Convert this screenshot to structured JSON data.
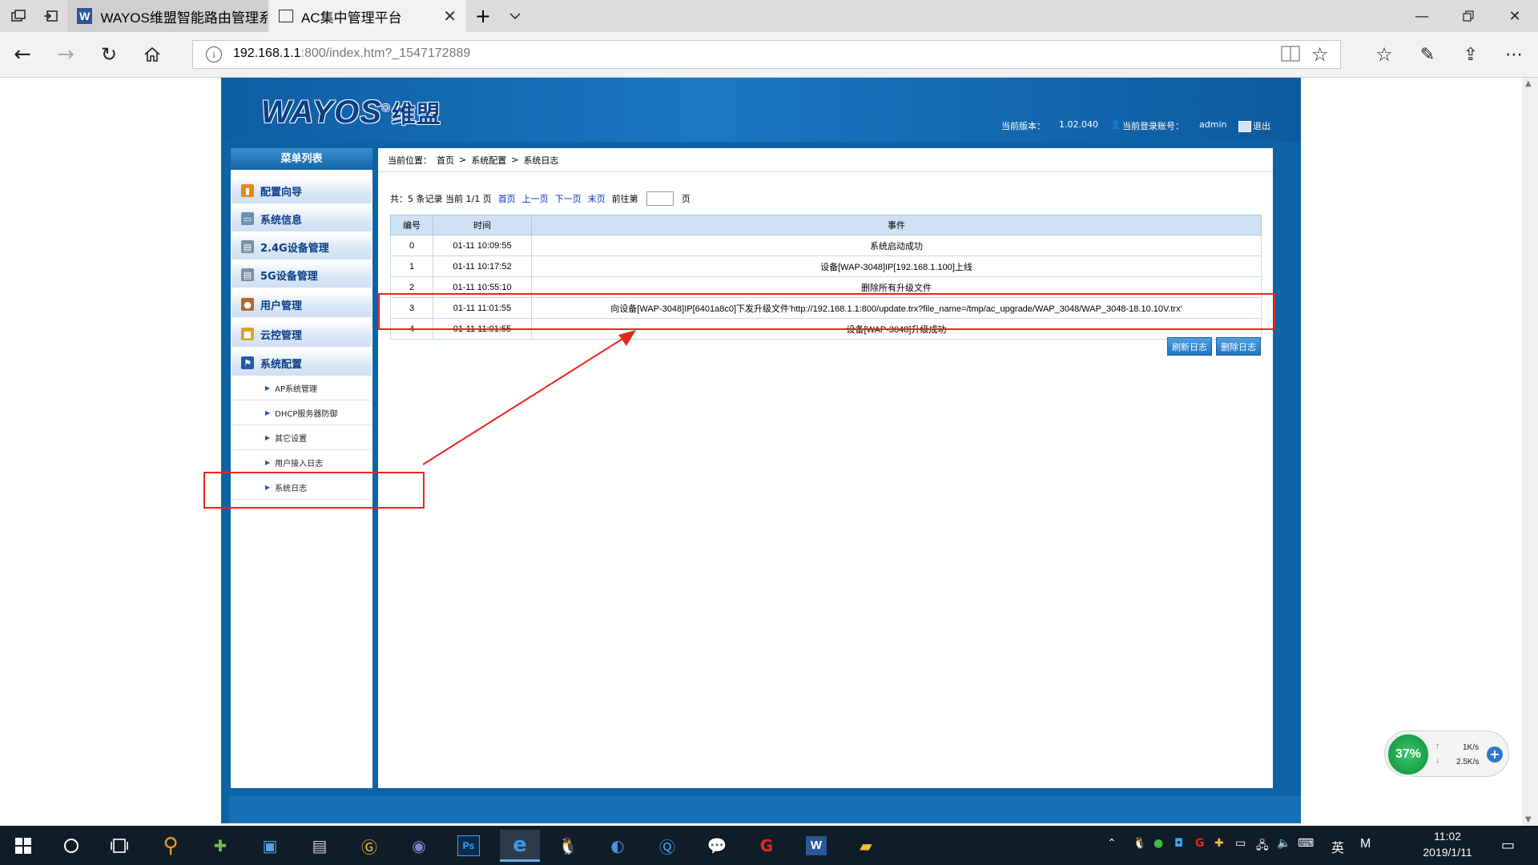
{
  "browser": {
    "tabs": [
      {
        "title": "WAYOS维盟智能路由管理系"
      },
      {
        "title": "AC集中管理平台"
      }
    ],
    "address": {
      "host": "192.168.1.1",
      "rest": ":800/index.htm?_1547172889"
    }
  },
  "header": {
    "brand": "WAYOS",
    "brand_cn": "维盟",
    "version_label": "当前版本：",
    "version": "1.02.040",
    "account_label": "当前登录账号：",
    "account": "admin",
    "logout": "退出"
  },
  "sidebar": {
    "title": "菜单列表",
    "items": [
      {
        "label": "配置向导",
        "icon": "wizard-icon"
      },
      {
        "label": "系统信息",
        "icon": "monitor-icon"
      },
      {
        "label": "2.4G设备管理",
        "icon": "device-icon"
      },
      {
        "label": "5G设备管理",
        "icon": "device-icon"
      },
      {
        "label": "用户管理",
        "icon": "user-icon"
      },
      {
        "label": "云控管理",
        "icon": "lock-icon"
      },
      {
        "label": "系统配置",
        "icon": "flag-icon"
      }
    ],
    "subitems": [
      {
        "label": "AP系统管理"
      },
      {
        "label": "DHCP服务器防御"
      },
      {
        "label": "其它设置"
      },
      {
        "label": "用户接入日志"
      },
      {
        "label": "系统日志"
      }
    ]
  },
  "breadcrumb": {
    "label": "当前位置：",
    "home": "首页",
    "section": "系统配置",
    "current": "系统日志"
  },
  "pager": {
    "summary": "共：5 条记录 当前 1/1 页",
    "first": "首页",
    "prev": "上一页",
    "next": "下一页",
    "last": "末页",
    "goto_label": "前往第",
    "goto_suffix": "页"
  },
  "table": {
    "headers": [
      "编号",
      "时间",
      "事件"
    ],
    "rows": [
      [
        "0",
        "01-11 10:09:55",
        "系统启动成功"
      ],
      [
        "1",
        "01-11 10:17:52",
        "设备[WAP-3048]IP[192.168.1.100]上线"
      ],
      [
        "2",
        "01-11 10:55:10",
        "删除所有升级文件"
      ],
      [
        "3",
        "01-11 11:01:55",
        "向设备[WAP-3048]IP[6401a8c0]下发升级文件'http://192.168.1.1:800/update.trx?file_name=/tmp/ac_upgrade/WAP_3048/WAP_3048-18.10.10V.trx'"
      ],
      [
        "4",
        "01-11 11:01:55",
        "设备[WAP-3048]升级成功"
      ]
    ]
  },
  "buttons": {
    "refresh": "刷新日志",
    "delete": "删除日志"
  },
  "network": {
    "percent": "37%",
    "up": "1K/s",
    "down": "2.5K/s"
  },
  "taskbar": {
    "ime": "英",
    "m": "M",
    "time": "11:02",
    "date": "2019/1/11"
  },
  "colors": {
    "accent": "#0d63a6",
    "annotation": "#e8261d",
    "link": "#0033cc"
  }
}
